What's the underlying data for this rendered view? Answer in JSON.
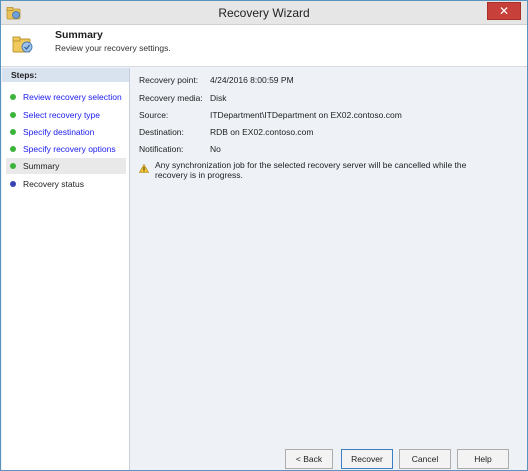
{
  "window": {
    "title": "Recovery Wizard",
    "close_glyph": "✕"
  },
  "header": {
    "title": "Summary",
    "subtitle": "Review your recovery settings."
  },
  "steps": {
    "heading": "Steps:",
    "items": [
      {
        "label": "Review recovery selection",
        "state": "done"
      },
      {
        "label": "Select recovery type",
        "state": "done"
      },
      {
        "label": "Specify destination",
        "state": "done"
      },
      {
        "label": "Specify recovery options",
        "state": "done"
      },
      {
        "label": "Summary",
        "state": "current"
      },
      {
        "label": "Recovery status",
        "state": "pending"
      }
    ]
  },
  "summary": {
    "recovery_point": {
      "label": "Recovery point:",
      "value": "4/24/2016 8:00:59 PM"
    },
    "recovery_media": {
      "label": "Recovery media:",
      "value": "Disk"
    },
    "source": {
      "label": "Source:",
      "value": "ITDepartment\\ITDepartment on EX02.contoso.com"
    },
    "destination": {
      "label": "Destination:",
      "value": "RDB on EX02.contoso.com"
    },
    "notification": {
      "label": "Notification:",
      "value": "No"
    },
    "warning": "Any synchronization job for the selected recovery server will be cancelled while the recovery is in progress."
  },
  "buttons": {
    "back": "< Back",
    "recover": "Recover",
    "cancel": "Cancel",
    "help": "Help"
  },
  "icons": {
    "app": "recovery-wizard-icon",
    "header": "summary-folder-icon",
    "warning": "warning-icon"
  },
  "colors": {
    "step_done_link": "#1a1aee",
    "step_done_dot": "#3cb43c",
    "step_pending_dot": "#3a42b8",
    "close_button": "#c7413a"
  }
}
